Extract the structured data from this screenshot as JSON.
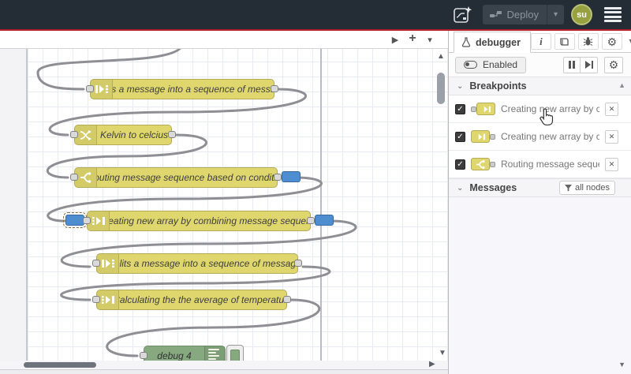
{
  "header": {
    "deploy": {
      "label": "Deploy"
    },
    "avatar": {
      "initials": "su"
    }
  },
  "icons": {
    "chevron_down": "▾",
    "section_chevron": "⌄",
    "scroll_up": "▲",
    "scroll_down": "▼",
    "tab_scroll_right": "▶",
    "hscroll_right": "▶",
    "add_flow": "+",
    "gear": "⚙",
    "info": "i",
    "check": "✓",
    "close": "✕"
  },
  "canvas": {
    "nodes": [
      {
        "id": "split-1",
        "type": "split",
        "label": "Splits a message into a sequence of messages."
      },
      {
        "id": "change-1",
        "type": "change",
        "label": "Kelvin to celcius"
      },
      {
        "id": "switch-1",
        "type": "switch",
        "label": "Routing message sequence based on condition"
      },
      {
        "id": "join-1",
        "type": "join",
        "label": "Creating new array by combining message sequence"
      },
      {
        "id": "split-2",
        "type": "split",
        "label": "Splits a message into a sequence of messages."
      },
      {
        "id": "join-2",
        "type": "join",
        "label": "Calculating the the average of temperature"
      },
      {
        "id": "debug-4",
        "type": "debug",
        "label": "debug 4"
      }
    ]
  },
  "sidebar": {
    "active_tab": "debugger",
    "toolbar": {
      "enabled_label": "Enabled"
    },
    "breakpoints": {
      "title": "Breakpoints",
      "items": [
        {
          "label": "Creating new array by combining message sequence",
          "checked": true
        },
        {
          "label": "Creating new array by combining message sequence",
          "checked": true
        },
        {
          "label": "Routing message sequence based on condition",
          "checked": true
        }
      ]
    },
    "messages": {
      "title": "Messages",
      "filter_label": "all nodes"
    }
  },
  "colors": {
    "header_bg": "#242d35",
    "accent_red": "#b51f28",
    "node_yellow": "#dfd76d",
    "node_green": "#87a980",
    "breakpoint_blue": "#4e8ed0",
    "wire_gray": "#8e8e94"
  }
}
